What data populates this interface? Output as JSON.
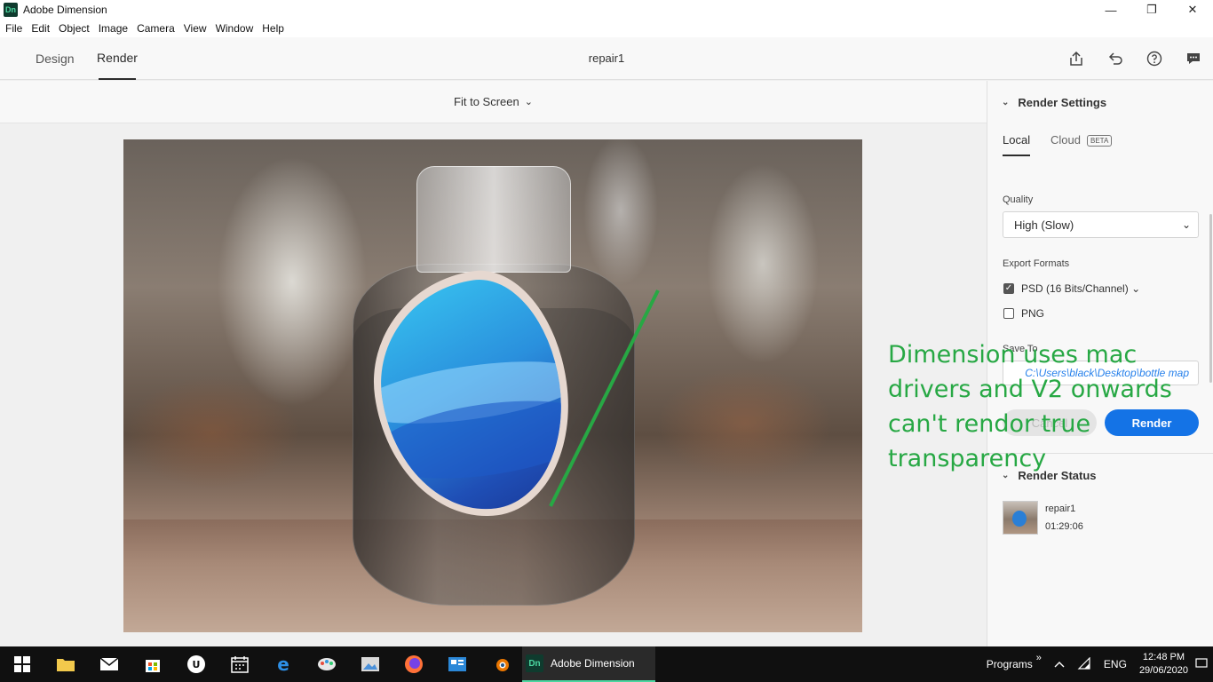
{
  "window": {
    "app_title": "Adobe Dimension",
    "logo_text": "Dn",
    "minimize": "—",
    "maximize": "❐",
    "close": "✕"
  },
  "menu": [
    "File",
    "Edit",
    "Object",
    "Image",
    "Camera",
    "View",
    "Window",
    "Help"
  ],
  "header": {
    "tabs": [
      {
        "label": "Design",
        "active": false
      },
      {
        "label": "Render",
        "active": true
      }
    ],
    "doc_title": "repair1",
    "icons": [
      "share-icon",
      "undo-icon",
      "help-icon",
      "feedback-icon"
    ]
  },
  "canvas": {
    "fit_label": "Fit to Screen"
  },
  "annotation": {
    "text": "Dimension uses mac drivers and V2 onwards can't rendor true transparency",
    "color": "#27a844"
  },
  "panel": {
    "render_settings": {
      "title": "Render Settings",
      "tabs": [
        {
          "label": "Local",
          "active": true
        },
        {
          "label": "Cloud",
          "active": false
        }
      ],
      "beta": "BETA",
      "quality_label": "Quality",
      "quality_value": "High (Slow)",
      "export_label": "Export Formats",
      "formats": [
        {
          "label": "PSD (16 Bits/Channel)",
          "checked": true
        },
        {
          "label": "PNG",
          "checked": false
        }
      ],
      "save_to_label": "Save To",
      "save_path": "C:\\Users\\black\\Desktop\\bottle map",
      "cancel_label": "Cancel",
      "render_label": "Render"
    },
    "render_status": {
      "title": "Render Status",
      "item_name": "repair1",
      "item_time": "01:29:06"
    }
  },
  "taskbar": {
    "active_app": "Adobe Dimension",
    "programs_label": "Programs",
    "lang": "ENG",
    "time": "12:48 PM",
    "date": "29/06/2020"
  },
  "colors": {
    "accent": "#1473e6",
    "annotation": "#27a844",
    "app_logo_bg": "#0f3b2e",
    "app_logo_fg": "#4cd6a0"
  }
}
